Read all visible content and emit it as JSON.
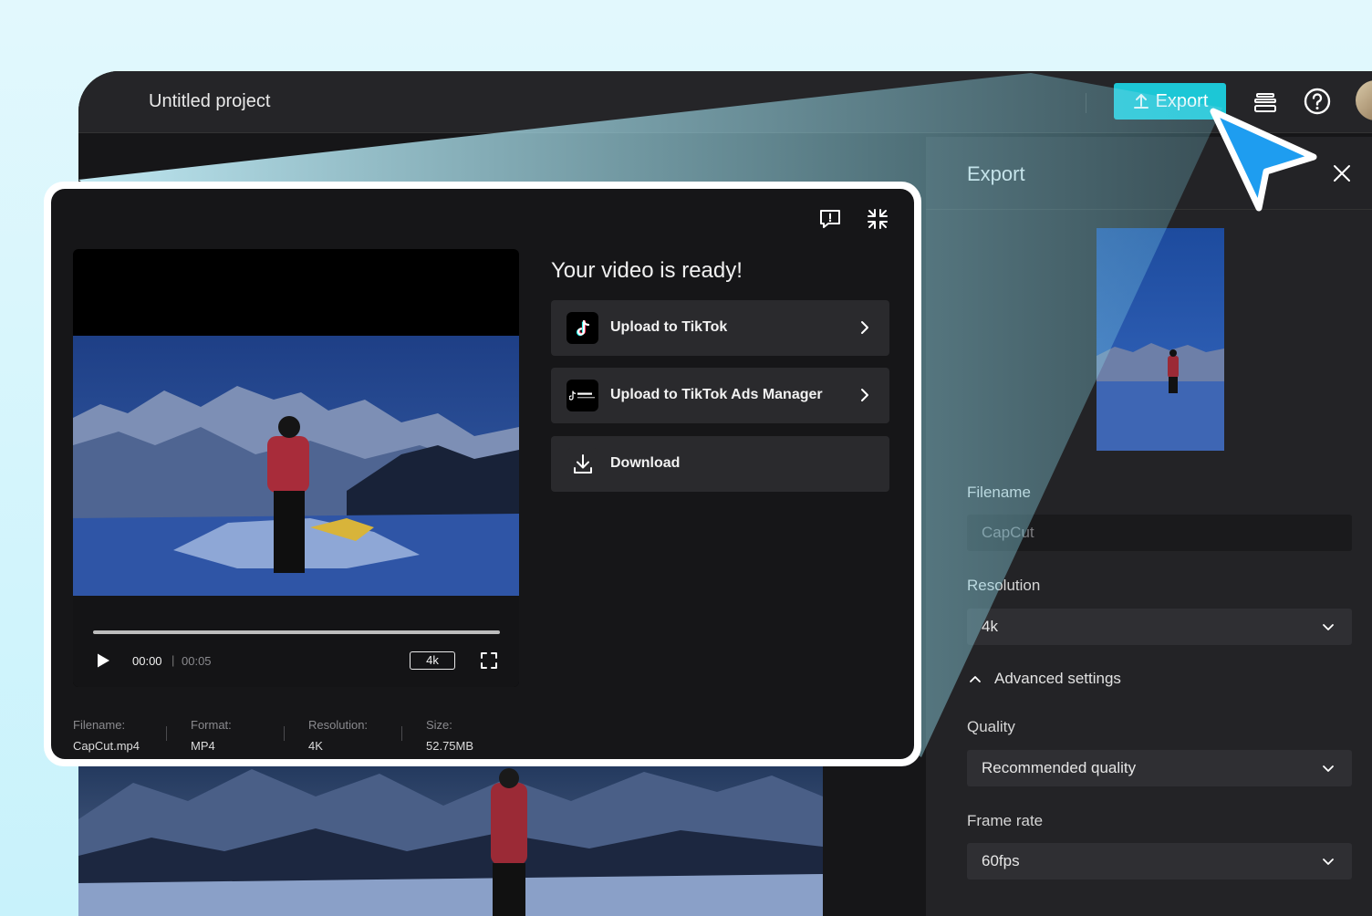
{
  "topbar": {
    "project_title": "Untitled project",
    "export_label": "Export",
    "icons": [
      "export-upload-icon",
      "layers-icon",
      "help-icon"
    ],
    "accent": "#1cc7d6"
  },
  "export_panel": {
    "title": "Export",
    "filename_label": "Filename",
    "filename_value": "CapCut",
    "resolution_label": "Resolution",
    "resolution_value": "4k",
    "advanced_label": "Advanced settings",
    "quality_label": "Quality",
    "quality_value": "Recommended quality",
    "framerate_label": "Frame rate",
    "framerate_value": "60fps"
  },
  "modal": {
    "heading": "Your video is ready!",
    "actions": [
      {
        "label": "Upload to TikTok",
        "icon": "tiktok-icon"
      },
      {
        "label": "Upload to TikTok Ads Manager",
        "icon": "tiktok-business-icon"
      },
      {
        "label": "Download",
        "icon": "download-icon"
      }
    ],
    "player": {
      "current_time": "00:00",
      "divider": "|",
      "total_time": "00:05",
      "quality_badge": "4k"
    },
    "meta": [
      {
        "key": "Filename:",
        "value": "CapCut.mp4"
      },
      {
        "key": "Format:",
        "value": "MP4"
      },
      {
        "key": "Resolution:",
        "value": "4K"
      },
      {
        "key": "Size:",
        "value": "52.75MB"
      }
    ]
  }
}
